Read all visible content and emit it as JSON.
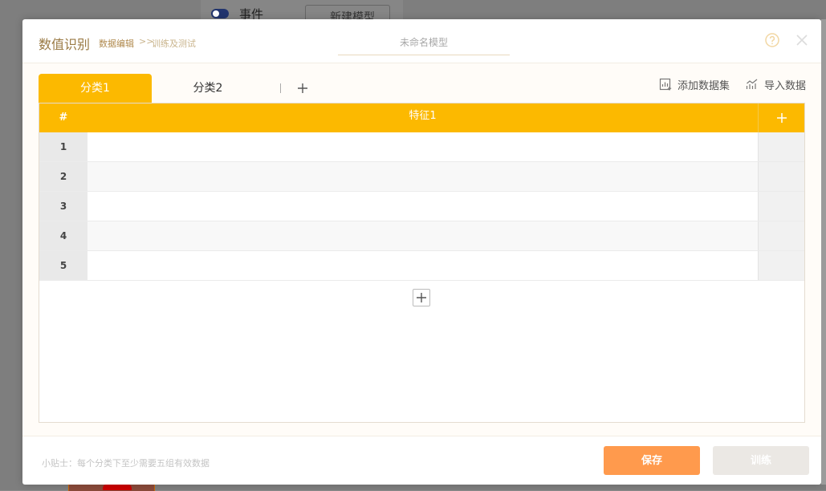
{
  "background": {
    "event_label": "事件",
    "new_model_label": "新建模型"
  },
  "dialog": {
    "title": "数值识别",
    "breadcrumb": {
      "current": "数据编辑",
      "separator": ">>",
      "next": "训练及测试"
    },
    "model_name": {
      "value": "",
      "placeholder": "未命名模型"
    },
    "icons": {
      "help": "help-circle-icon",
      "close": "close-icon"
    }
  },
  "tabs": [
    {
      "label": "分类1",
      "active": true
    },
    {
      "label": "分类2",
      "active": false
    }
  ],
  "actions": {
    "add_dataset": "添加数据集",
    "import_data": "导入数据"
  },
  "table": {
    "headers": {
      "index": "#",
      "feature": "特征1"
    },
    "rows": [
      {
        "index": "1",
        "value": ""
      },
      {
        "index": "2",
        "value": ""
      },
      {
        "index": "3",
        "value": ""
      },
      {
        "index": "4",
        "value": ""
      },
      {
        "index": "5",
        "value": ""
      }
    ]
  },
  "footer": {
    "tip": "小贴士：每个分类下至少需要五组有效数据",
    "save_label": "保存",
    "train_label": "训练"
  },
  "colors": {
    "accent": "#fcb900",
    "save": "#ff9a4d",
    "disabled": "#ebe8e4",
    "title": "#9a7a44"
  }
}
